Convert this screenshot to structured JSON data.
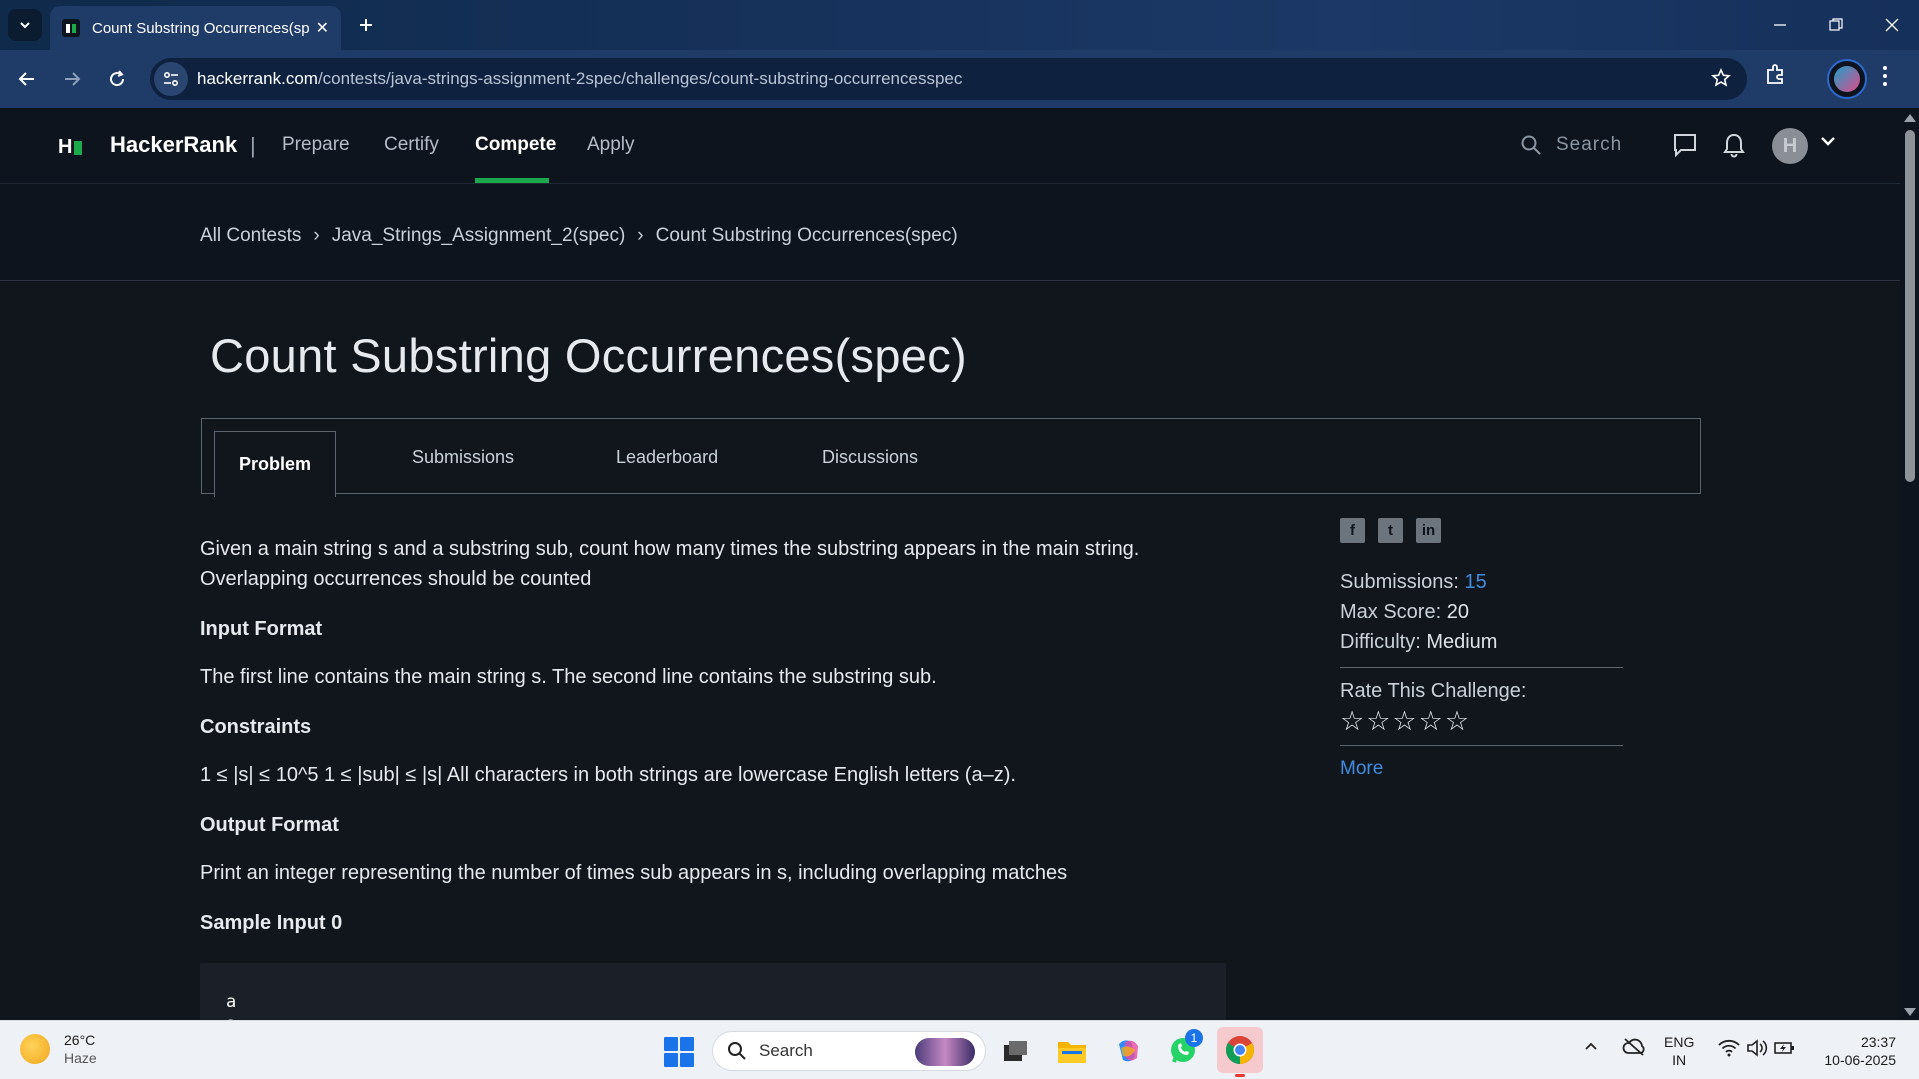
{
  "browser": {
    "tab_title": "Count Substring Occurrences(sp",
    "url_host": "hackerrank.com",
    "url_path": "/contests/java-strings-assignment-2spec/challenges/count-substring-occurrencesspec"
  },
  "hr_nav": {
    "brand": "HackerRank",
    "separator": "|",
    "links": [
      "Prepare",
      "Certify",
      "Compete",
      "Apply"
    ],
    "active_link": "Compete",
    "search_placeholder": "Search"
  },
  "breadcrumb": [
    "All Contests",
    "Java_Strings_Assignment_2(spec)",
    "Count Substring Occurrences(spec)"
  ],
  "page_title": "Count Substring Occurrences(spec)",
  "tabs": [
    "Problem",
    "Submissions",
    "Leaderboard",
    "Discussions"
  ],
  "active_tab": "Problem",
  "problem": {
    "intro": "Given a main string s and a substring sub, count how many times the substring appears in the main string. Overlapping occurrences should be counted",
    "input_heading": "Input Format",
    "input_text": "The first line contains the main string s. The second line contains the substring sub.",
    "constraints_heading": "Constraints",
    "constraints_text": "1 ≤ |s| ≤ 10^5 1 ≤ |sub| ≤ |s| All characters in both strings are lowercase English letters (a–z).",
    "output_heading": "Output Format",
    "output_text": "Print an integer representing the number of times sub appears in s, including overlapping matches",
    "sample_heading": "Sample Input 0",
    "sample_input": "a\na"
  },
  "sidebar": {
    "share_icons": [
      "facebook-icon",
      "twitter-icon",
      "linkedin-icon"
    ],
    "submissions_label": "Submissions:",
    "submissions_value": "15",
    "max_score_label": "Max Score:",
    "max_score_value": "20",
    "difficulty_label": "Difficulty:",
    "difficulty_value": "Medium",
    "rate_label": "Rate This Challenge:",
    "stars": "☆☆☆☆☆",
    "more_link": "More"
  },
  "taskbar": {
    "weather_temp": "26°C",
    "weather_desc": "Haze",
    "search_placeholder": "Search",
    "whatsapp_badge": "1",
    "lang_top": "ENG",
    "lang_bottom": "IN",
    "time": "23:37",
    "date": "10-06-2025"
  },
  "colors": {
    "accent_green": "#1ba94c",
    "link_blue": "#3f8ce0",
    "page_bg": "#11161c",
    "nav_bg": "#0e141e"
  }
}
